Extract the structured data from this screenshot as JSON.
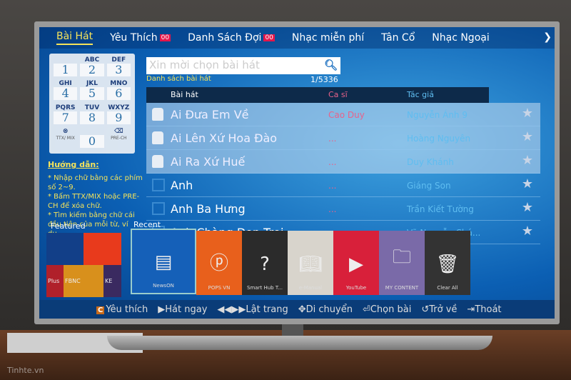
{
  "tabs": [
    {
      "label": "Bài Hát",
      "active": true
    },
    {
      "label": "Yêu Thích",
      "badge": "00"
    },
    {
      "label": "Danh Sách Đợi",
      "badge": "00"
    },
    {
      "label": "Nhạc miễn phí"
    },
    {
      "label": "Tân Cổ"
    },
    {
      "label": "Nhạc Ngoại"
    }
  ],
  "keypad": [
    {
      "l": "",
      "n": "1"
    },
    {
      "l": "ABC",
      "n": "2"
    },
    {
      "l": "DEF",
      "n": "3"
    },
    {
      "l": "GHI",
      "n": "4"
    },
    {
      "l": "JKL",
      "n": "5"
    },
    {
      "l": "MNO",
      "n": "6"
    },
    {
      "l": "PQRS",
      "n": "7"
    },
    {
      "l": "TUV",
      "n": "8"
    },
    {
      "l": "WXYZ",
      "n": "9"
    },
    {
      "l": "⊗",
      "n": "TTX/ MIX"
    },
    {
      "l": "",
      "n": "0"
    },
    {
      "l": "⌫",
      "n": "PRE-CH"
    }
  ],
  "guide": {
    "title": "Hướng dẫn:",
    "lines": [
      "* Nhập chữ bằng các phím số 2~9.",
      "* Bấm TTX/MIX hoặc PRE-CH để xóa chữ.",
      "* Tìm kiếm bằng chữ cái đầu tiên của mỗi từ, ví dụ..."
    ]
  },
  "search": {
    "placeholder": "Xin mời chọn bài hát"
  },
  "list": {
    "label": "Danh sách bài hát",
    "count": "1/5336",
    "headers": {
      "song": "Bài hát",
      "singer": "Ca sĩ",
      "author": "Tác giả"
    },
    "rows": [
      {
        "title": "Ai Đưa Em Về",
        "singer": "Cao Duy",
        "author": "Nguyễn Ánh 9",
        "locked": true
      },
      {
        "title": "Ai Lên Xứ Hoa Đào",
        "singer": "...",
        "author": "Hoàng Nguyên",
        "locked": true
      },
      {
        "title": "Ai Ra Xứ Huế",
        "singer": "...",
        "author": "Duy Khánh",
        "locked": true
      },
      {
        "title": "Anh",
        "singer": "...",
        "author": "Giáng Son",
        "locked": false
      },
      {
        "title": "Anh Ba Hưng",
        "singer": "...",
        "author": "Trần Kiết Tường",
        "locked": false
      },
      {
        "title": "Anh Chàng Dọn Trọi",
        "singer": "",
        "author": "Võ Nguyễn Chá...",
        "locked": false
      }
    ]
  },
  "hub": {
    "featured": "Featured",
    "recent": "Recent",
    "featured_tiles": [
      "Plus",
      "FBNC",
      "KE"
    ],
    "tiles": [
      {
        "label": "NewsON",
        "color": "#1560b8",
        "icon": "news-icon"
      },
      {
        "label": "POPS VN",
        "color": "#e8601c",
        "icon": "pops-icon"
      },
      {
        "label": "Smart Hub T...",
        "color": "#2b2b2b",
        "icon": "help-icon"
      },
      {
        "label": "e-Manual",
        "color": "#d8d4cc",
        "icon": "book-icon"
      },
      {
        "label": "YouTube",
        "color": "#d8203a",
        "icon": "youtube-icon"
      },
      {
        "label": "MY CONTENT",
        "color": "#7a6aa8",
        "icon": "folder-icon"
      },
      {
        "label": "Clear All",
        "color": "#333",
        "icon": "trash-icon"
      }
    ]
  },
  "bottom": {
    "fav": "Yêu thích",
    "fav_key": "C",
    "play": "Hát ngay",
    "page": "Lật trang",
    "move": "Di chuyển",
    "select": "Chọn bài",
    "back": "Trở về",
    "exit": "Thoát"
  },
  "watermark": "Tinhte.vn"
}
